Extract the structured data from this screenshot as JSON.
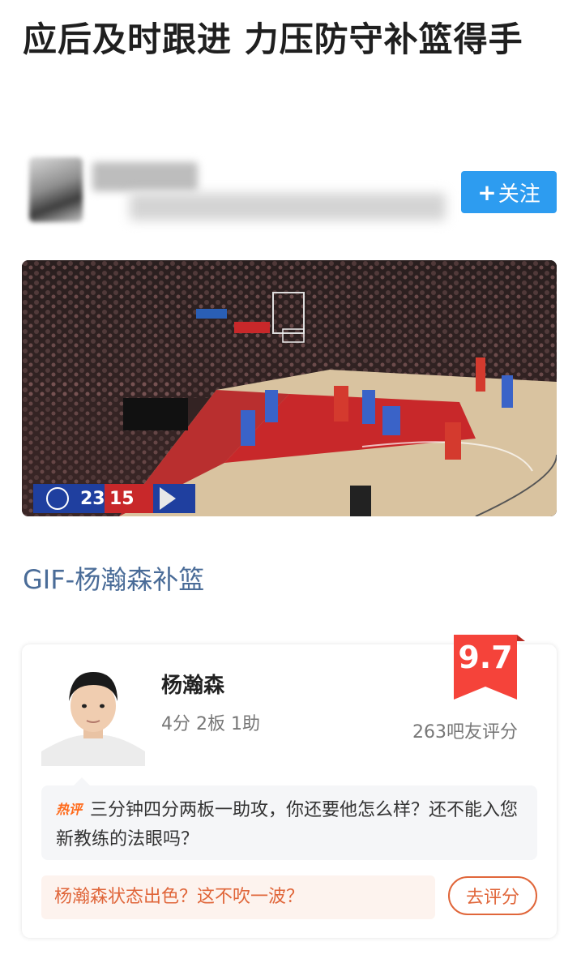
{
  "article": {
    "title": "应后及时跟进 力压防守补篮得手",
    "follow_label": "关注",
    "caption": "GIF-杨瀚森补篮"
  },
  "scoreboard": {
    "away_score": "23",
    "home_score": "15"
  },
  "player_card": {
    "name": "杨瀚森",
    "stats": "4分 2板 1助",
    "score": "9.7",
    "rating_count": "263吧友评分",
    "hot_tag": "热评",
    "hot_review": "三分钟四分两板一助攻，你还要他怎么样？还不能入您新教练的法眼吗？",
    "prompt": "杨瀚森状态出色？这不吹一波？",
    "rate_button": "去评分"
  },
  "colors": {
    "follow_button": "#2d9cf0",
    "caption": "#4a6c98",
    "accent": "#e0663a",
    "badge": "#f5433a"
  }
}
